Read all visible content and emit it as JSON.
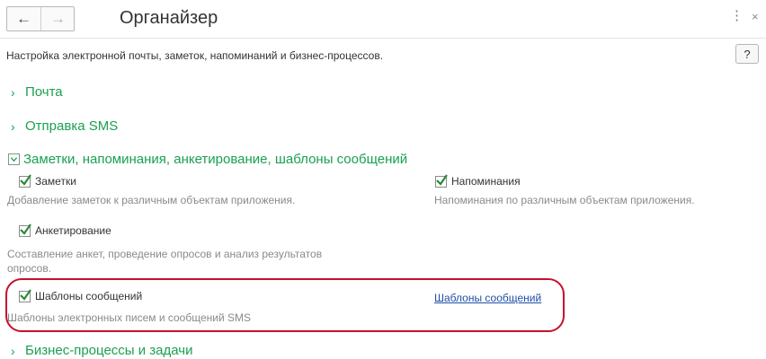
{
  "window": {
    "title": "Органайзер",
    "description": "Настройка электронной почты, заметок, напоминаний и бизнес-процессов.",
    "help_label": "?",
    "more_label": "⋮",
    "close_label": "×",
    "back_label": "←",
    "forward_label": "→"
  },
  "sections": {
    "mail": {
      "label": "Почта",
      "chevron": "›"
    },
    "sms": {
      "label": "Отправка SMS",
      "chevron": "›"
    },
    "notes": {
      "label": "Заметки, напоминания, анкетирование, шаблоны сообщений"
    },
    "bp": {
      "label": "Бизнес-процессы и задачи",
      "chevron": "›"
    }
  },
  "options": {
    "notes": {
      "label": "Заметки",
      "checked": true,
      "hint": "Добавление заметок к различным объектам приложения."
    },
    "reminders": {
      "label": "Напоминания",
      "checked": true,
      "hint": "Напоминания по различным объектам приложения."
    },
    "survey": {
      "label": "Анкетирование",
      "checked": true,
      "hint_line1": "Составление анкет, проведение опросов и анализ результатов",
      "hint_line2": "опросов."
    },
    "templates": {
      "label": "Шаблоны сообщений",
      "checked": true,
      "hint": "Шаблоны электронных писем и сообщений SMS",
      "link": "Шаблоны сообщений"
    }
  },
  "colors": {
    "section_green": "#1aa050",
    "check_green": "#2a8a3a",
    "link_blue": "#1f4fa8",
    "highlight_red": "#c8102e"
  }
}
